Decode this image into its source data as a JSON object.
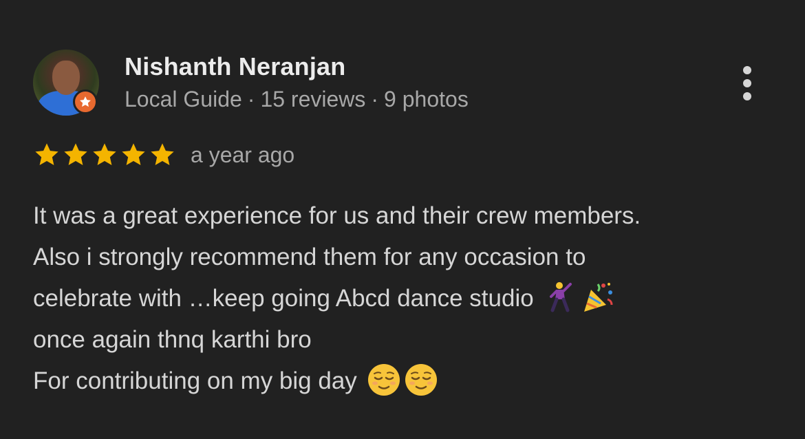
{
  "reviewer": {
    "name": "Nishanth Neranjan",
    "badge": "Local Guide",
    "reviews": "15 reviews",
    "photos": "9 photos",
    "separator": "·"
  },
  "rating": {
    "stars": 5,
    "max": 5,
    "star_color": "#f4b400"
  },
  "timestamp": "a year ago",
  "review_lines": [
    "It was a great experience for us and their crew members.",
    "Also i strongly recommend them for any occasion to",
    "celebrate with …keep going Abcd dance studio",
    "once again thnq karthi bro",
    "For contributing on my big day"
  ],
  "emojis": {
    "line3": [
      "man-dancing-icon",
      "party-popper-icon"
    ],
    "line5": [
      "relieved-face-icon",
      "relieved-face-icon"
    ]
  },
  "colors": {
    "background": "#212121",
    "badge_orange": "#e8692f"
  }
}
